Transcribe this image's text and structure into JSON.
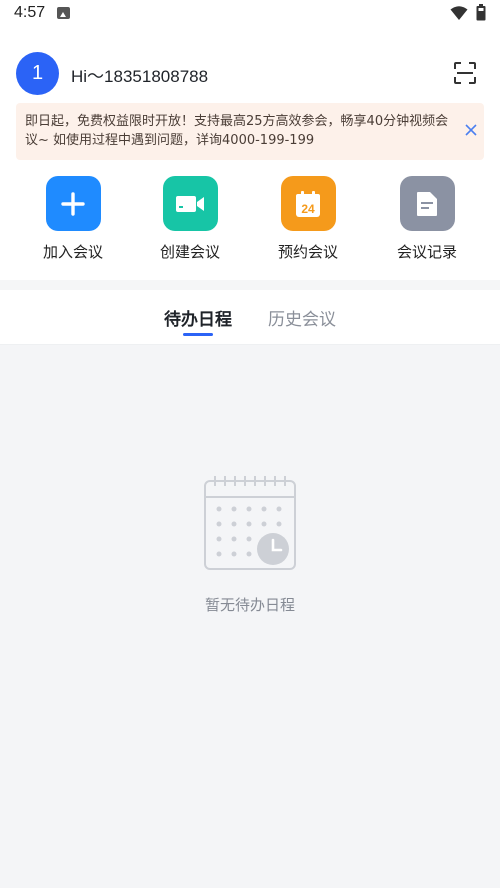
{
  "status_bar": {
    "time": "4:57"
  },
  "header": {
    "avatar_text": "1",
    "greeting": "Hi～18351808788"
  },
  "notice": {
    "text": "即日起，免费权益限时开放！支持最高25方高效参会，畅享40分钟视频会议~ 如使用过程中遇到问题，详询4000-199-199"
  },
  "quick_actions": [
    {
      "label": "加入会议",
      "icon": "plus-icon",
      "color": "#1f8bff"
    },
    {
      "label": "创建会议",
      "icon": "video-camera-icon",
      "color": "#17c5a6"
    },
    {
      "label": "预约会议",
      "icon": "calendar-24-icon",
      "color": "#f59a1b"
    },
    {
      "label": "会议记录",
      "icon": "document-icon",
      "color": "#8b92a3"
    }
  ],
  "calendar_badge": "24",
  "tabs": [
    {
      "label": "待办日程",
      "active": true
    },
    {
      "label": "历史会议",
      "active": false
    }
  ],
  "empty_state": {
    "text": "暂无待办日程"
  },
  "colors": {
    "accent": "#2b63f6",
    "notice_bg": "#fdf1ea",
    "content_bg": "#f4f5f7"
  }
}
